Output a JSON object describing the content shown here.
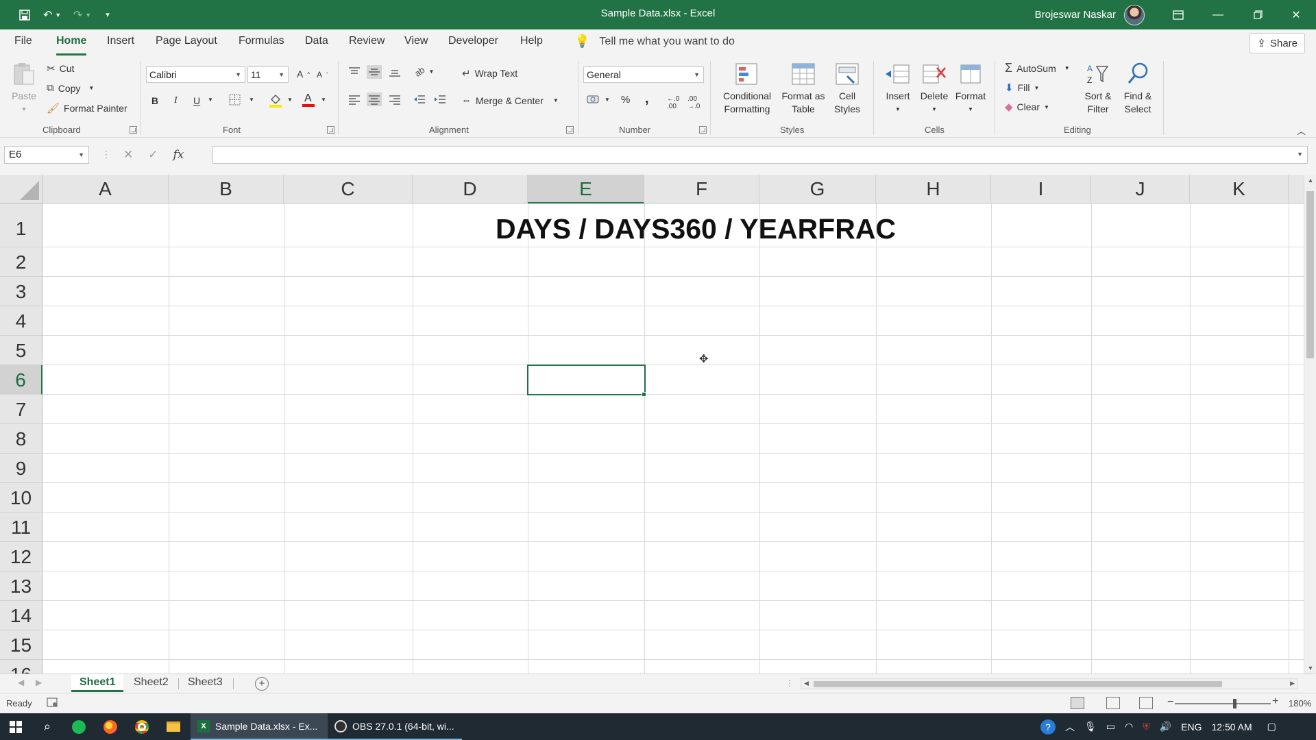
{
  "window": {
    "title": "Sample Data.xlsx  -  Excel",
    "user_name": "Brojeswar Naskar",
    "colors": {
      "title_bar": "#217346",
      "accent": "#217346",
      "taskbar": "#1f2a33"
    },
    "quick_access": {
      "save_icon": "save-icon",
      "undo_icon": "undo-icon",
      "redo_icon": "redo-icon"
    }
  },
  "ribbon_tabs": [
    "File",
    "Home",
    "Insert",
    "Page Layout",
    "Formulas",
    "Data",
    "Review",
    "View",
    "Developer",
    "Help"
  ],
  "active_tab": "Home",
  "tell_me": "Tell me what you want to do",
  "share": "Share",
  "clipboard": {
    "paste": "Paste",
    "cut": "Cut",
    "copy": "Copy",
    "format_painter": "Format Painter",
    "group": "Clipboard"
  },
  "font": {
    "name": "Calibri",
    "size": "11",
    "bold": "B",
    "italic": "I",
    "underline": "U",
    "group": "Font"
  },
  "alignment": {
    "wrap_text": "Wrap Text",
    "merge_center": "Merge & Center",
    "group": "Alignment"
  },
  "number": {
    "format": "General",
    "percent": "%",
    "comma": ",",
    "group": "Number"
  },
  "styles": {
    "conditional_1": "Conditional",
    "conditional_2": "Formatting",
    "format_table_1": "Format as",
    "format_table_2": "Table",
    "cell_styles_1": "Cell",
    "cell_styles_2": "Styles",
    "group": "Styles"
  },
  "cells": {
    "insert": "Insert",
    "delete": "Delete",
    "format": "Format",
    "group": "Cells"
  },
  "editing": {
    "autosum": "AutoSum",
    "fill": "Fill",
    "clear": "Clear",
    "sort_1": "Sort &",
    "sort_2": "Filter",
    "find_1": "Find &",
    "find_2": "Select",
    "group": "Editing"
  },
  "formula_bar": {
    "name_box": "E6",
    "fx": "fx",
    "cancel": "✕",
    "enter": "✓",
    "value": ""
  },
  "grid": {
    "columns": [
      "A",
      "B",
      "C",
      "D",
      "E",
      "F",
      "G",
      "H",
      "I",
      "J",
      "K"
    ],
    "rows": [
      "1",
      "2",
      "3",
      "4",
      "5",
      "6",
      "7",
      "8",
      "9",
      "10",
      "11",
      "12",
      "13",
      "14",
      "15",
      "16"
    ],
    "selected_column": "E",
    "selected_row": "6",
    "heading": "DAYS / DAYS360 /  YEARFRAC"
  },
  "sheets": [
    "Sheet1",
    "Sheet2",
    "Sheet3"
  ],
  "active_sheet": "Sheet1",
  "status": {
    "ready": "Ready",
    "zoom": "180%"
  },
  "taskbar": {
    "apps": [
      "Sample Data.xlsx - Ex...",
      "OBS 27.0.1 (64-bit, wi..."
    ],
    "lang": "ENG",
    "time": "12:50 AM"
  }
}
